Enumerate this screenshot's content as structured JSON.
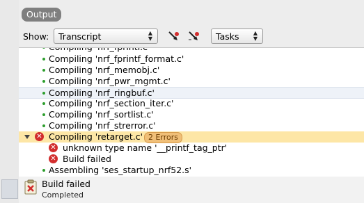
{
  "panel": {
    "title": "Output"
  },
  "toolbar": {
    "show_label": "Show:",
    "show_value": "Transcript",
    "tasks_value": "Tasks"
  },
  "transcript": {
    "rows": [
      {
        "text": "Compiling 'nrf_fprintf.c'"
      },
      {
        "text": "Compiling 'nrf_fprintf_format.c'"
      },
      {
        "text": "Compiling 'nrf_memobj.c'"
      },
      {
        "text": "Compiling 'nrf_pwr_mgmt.c'"
      },
      {
        "text": "Compiling 'nrf_ringbuf.c'"
      },
      {
        "text": "Compiling 'nrf_section_iter.c'"
      },
      {
        "text": "Compiling 'nrf_sortlist.c'"
      },
      {
        "text": "Compiling 'nrf_strerror.c'"
      },
      {
        "text": "Compiling 'retarget.c'",
        "badge": "2 Errors"
      },
      {
        "text": "unknown type name '__printf_tag_ptr'"
      },
      {
        "text": "Build failed"
      },
      {
        "text": "Assembling 'ses_startup_nrf52.s'"
      }
    ]
  },
  "status": {
    "title": "Build failed",
    "subtitle": "Completed"
  },
  "colors": {
    "error_row": "#fde6a6",
    "error_icon": "#d22d2d",
    "success_bullet": "#2e9e2e",
    "badge": "#f0bf78"
  }
}
